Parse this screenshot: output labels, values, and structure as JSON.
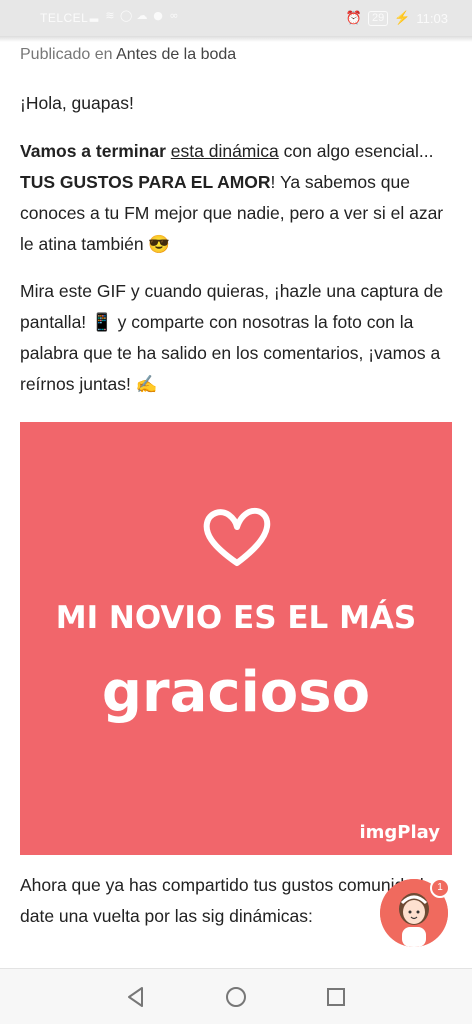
{
  "status_bar": {
    "carrier": "TELCEL",
    "battery": "29",
    "time": "11:03"
  },
  "post": {
    "published_prefix": "Publicado en",
    "category": "Antes de la boda",
    "greeting": "¡Hola, guapas!",
    "p1_bold1": "Vamos a terminar",
    "p1_link": "esta dinámica",
    "p1_text1": "con algo esencial...",
    "p1_bold2": "TUS GUSTOS PARA EL AMOR",
    "p1_text2": "! Ya sabemos que conoces a tu FM mejor que nadie, pero a ver si el azar le atina también 😎",
    "p2_text": "Mira este GIF y cuando quieras, ¡hazle una captura de pantalla! 📱 y comparte con nosotras la foto con la palabra que te ha salido en los comentarios, ¡vamos a reírnos juntas! ✍️",
    "after_text": "Ahora que ya has compartido tus gustos comunidad, date una vuelta por las sig dinámicas:"
  },
  "gif": {
    "line1": "MI NOVIO ES EL MÁS",
    "line2": "gracioso",
    "watermark": "imgPlay",
    "background": "#f1666b"
  },
  "chat": {
    "badge_count": "1"
  },
  "icons": {
    "nav_back": "back-triangle-icon",
    "nav_home": "home-circle-icon",
    "nav_recent": "recent-square-icon"
  }
}
